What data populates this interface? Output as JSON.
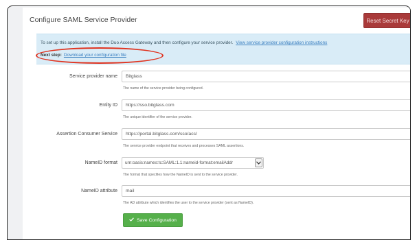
{
  "panel": {
    "title": "Configure SAML Service Provider",
    "reset_button": "Reset Secret Key"
  },
  "info": {
    "line1_text": "To set up this application, install the Duo Access Gateway and then configure your service provider.",
    "line1_link": "View service provider configuration instructions",
    "next_step_label": "Next step:",
    "next_step_link": "Download your configuration file"
  },
  "form": {
    "fields": [
      {
        "label": "Service provider name",
        "value": "Bitglass",
        "help": "The name of the service provider being configured."
      },
      {
        "label": "Entity ID",
        "value": "https://sso.bitglass.com",
        "help": "The unique identifier of the service provider."
      },
      {
        "label": "Assertion Consumer Service",
        "value": "https://portal.bitglass.com/sso/acs/",
        "help": "The service provider endpoint that receives and processes SAML assertions."
      },
      {
        "label": "NameID format",
        "value": "urn:oasis:names:tc:SAML:1.1:nameid-format:emailAddr",
        "help": "The format that specifies how the NameID is sent to the service provider."
      },
      {
        "label": "NameID attribute",
        "value": "mail",
        "help": "The AD attribute which identifies the user to the service provider (sent as NameID)."
      }
    ],
    "save_button": "Save Configuration"
  },
  "colors": {
    "reset_button_bg": "#a93a3a",
    "info_bg": "#d9ecf7",
    "link": "#3a7fc0",
    "save_button_bg": "#56b04b",
    "highlight": "#e0321e"
  },
  "icons": {
    "save": "check-icon",
    "select": "chevron-down-icon"
  }
}
